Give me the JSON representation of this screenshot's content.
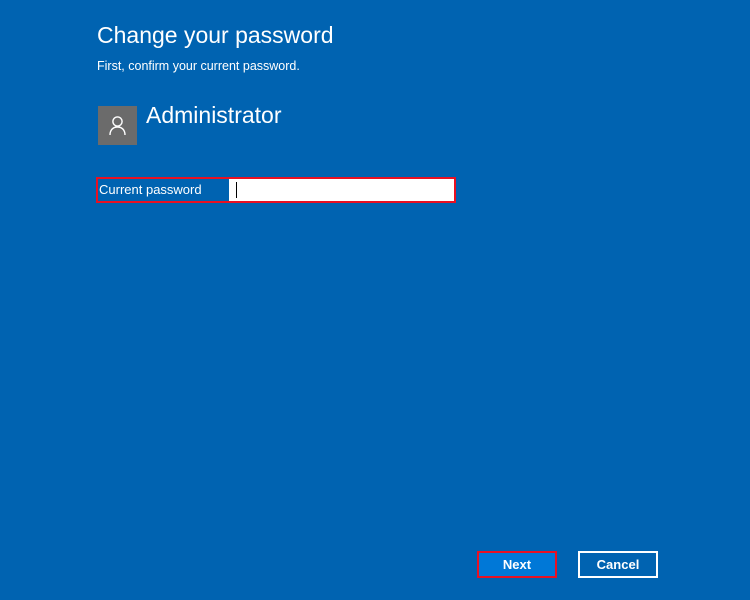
{
  "header": {
    "title": "Change your password",
    "subtitle": "First, confirm your current password."
  },
  "user": {
    "name": "Administrator",
    "avatar_icon": "person-icon"
  },
  "form": {
    "current_password_label": "Current password",
    "current_password_value": ""
  },
  "buttons": {
    "next_label": "Next",
    "cancel_label": "Cancel"
  },
  "colors": {
    "background": "#0063b1",
    "primary_button": "#0078d7",
    "highlight_border": "#e81123",
    "avatar_bg": "#6b6b6b"
  }
}
